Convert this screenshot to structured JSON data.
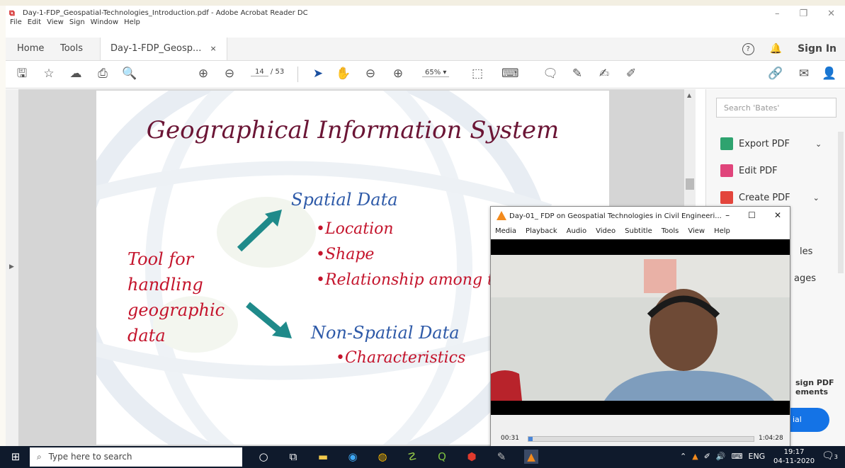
{
  "window": {
    "title": "Day-1-FDP_Geospatial-Technologies_Introduction.pdf - Adobe Acrobat Reader DC",
    "menu": [
      "File",
      "Edit",
      "View",
      "Sign",
      "Window",
      "Help"
    ]
  },
  "tabs": {
    "home": "Home",
    "tools": "Tools",
    "doc": "Day-1-FDP_Geosp...",
    "close": "×",
    "sign_in": "Sign In"
  },
  "toolbar": {
    "page_current": "14",
    "page_total": "/ 53",
    "zoom": "65%"
  },
  "slide": {
    "title": "Geographical Information System",
    "left_text": [
      "Tool for",
      "handling",
      "geographic",
      "data"
    ],
    "spatial_heading": "Spatial Data",
    "spatial_items": [
      "•Location",
      "•Shape",
      "•Relationship among th"
    ],
    "nonspatial_heading": "Non-Spatial Data",
    "nonspatial_items": [
      "•Characteristics"
    ]
  },
  "right_panel": {
    "search_placeholder": "Search 'Bates'",
    "items": [
      {
        "label": "Export PDF",
        "color": "#2ea36f"
      },
      {
        "label": "Edit PDF",
        "color": "#e0457b"
      },
      {
        "label": "Create PDF",
        "color": "#e3453c"
      }
    ],
    "partial_1": "les",
    "partial_2": "ages",
    "promo_1": "sign PDF",
    "promo_2": "ements",
    "promo_button": "ial"
  },
  "vlc": {
    "title": "Day-01_ FDP on Geospatial Technologies in Civil Engineeri...",
    "menu": [
      "Media",
      "Playback",
      "Audio",
      "Video",
      "Subtitle",
      "Tools",
      "View",
      "Help"
    ],
    "time_elapsed": "00:31",
    "time_total": "1:04:28",
    "progress": 0.008
  },
  "taskbar": {
    "search_placeholder": "Type here to search",
    "lang": "ENG",
    "time": "19:17",
    "date": "04-11-2020",
    "notif_count": "3"
  }
}
